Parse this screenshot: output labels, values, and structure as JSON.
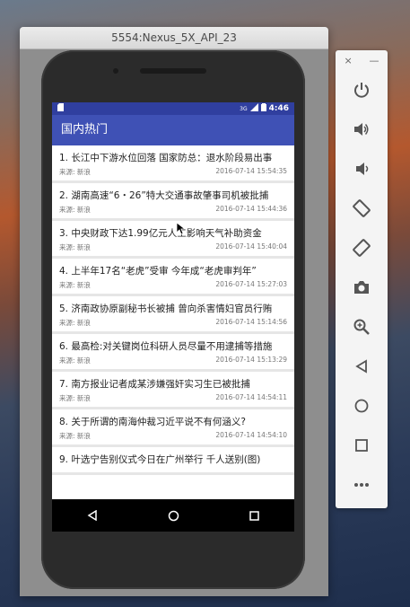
{
  "window": {
    "title": "5554:Nexus_5X_API_23"
  },
  "status_bar": {
    "time": "4:46",
    "network": "3G"
  },
  "app_bar": {
    "title": "国内热门"
  },
  "news": [
    {
      "title": "1. 长江中下游水位回落 国家防总：退水阶段易出事",
      "source": "来源: 新浪",
      "time": "2016-07-14 15:54:35"
    },
    {
      "title": "2. 湖南高速“6・26”特大交通事故肇事司机被批捕",
      "source": "来源: 新浪",
      "time": "2016-07-14 15:44:36"
    },
    {
      "title": "3. 中央财政下达1.99亿元人工影响天气补助资金",
      "source": "来源: 新浪",
      "time": "2016-07-14 15:40:04"
    },
    {
      "title": "4. 上半年17名“老虎”受审 今年成“老虎审判年”",
      "source": "来源: 新浪",
      "time": "2016-07-14 15:27:03"
    },
    {
      "title": "5. 济南政协原副秘书长被捕 曾向杀害情妇官员行贿",
      "source": "来源: 新浪",
      "time": "2016-07-14 15:14:56"
    },
    {
      "title": "6. 最高检:对关键岗位科研人员尽量不用逮捕等措施",
      "source": "来源: 新浪",
      "time": "2016-07-14 15:13:29"
    },
    {
      "title": "7. 南方报业记者成某涉嫌强奸实习生已被批捕",
      "source": "来源: 新浪",
      "time": "2016-07-14 14:54:11"
    },
    {
      "title": "8. 关于所谓的南海仲裁习近平说不有何涵义?",
      "source": "来源: 新浪",
      "time": "2016-07-14 14:54:10"
    },
    {
      "title": "9. 叶选宁告别仪式今日在广州举行 千人送别(图)",
      "source": "",
      "time": ""
    }
  ],
  "side_toolbar": {
    "close": "×",
    "minimize": "—",
    "buttons": [
      "power-icon",
      "volume-up-icon",
      "volume-down-icon",
      "rotate-left-icon",
      "rotate-right-icon",
      "camera-icon",
      "zoom-icon",
      "back-icon",
      "home-icon",
      "overview-icon",
      "more-icon"
    ]
  },
  "colors": {
    "primary": "#3f51b5",
    "primary_dark": "#303f9f"
  }
}
